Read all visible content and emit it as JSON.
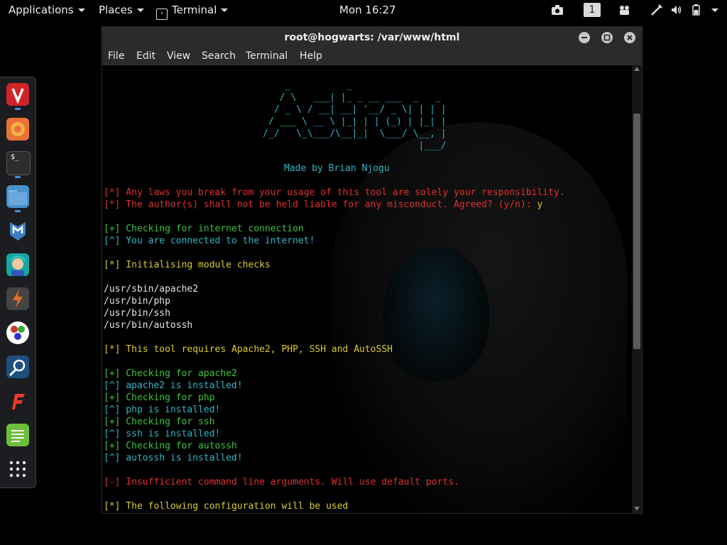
{
  "topbar": {
    "applications": "Applications",
    "places": "Places",
    "terminal": "Terminal",
    "clock": "Mon 16:27",
    "workspace": "1"
  },
  "window": {
    "title": "root@hogwarts: /var/www/html",
    "menu": [
      "File",
      "Edit",
      "View",
      "Search",
      "Terminal",
      "Help"
    ]
  },
  "dock": {
    "apps": [
      "vivaldi-icon",
      "firefox-icon",
      "terminal-icon",
      "files-icon",
      "metasploit-icon",
      "avatar-app-icon",
      "burpsuite-icon",
      "color-app-icon",
      "maltego-icon",
      "freeplane-icon",
      "notes-icon",
      "show-apps-icon"
    ]
  },
  "terminal": {
    "banner": [
      "        _          _",
      "       / \\   ___| |_ _ __ ___  _   _",
      "      / _ \\ / __| __| '__/ _ \\| | | |",
      "     / ___ \\ __ \\ |_| | | (_) | |_| |",
      "    /_/   \\_\\___/\\__|_|  \\___/ \\__, |",
      "                                |___/"
    ],
    "made_by": "Made by Brian Njogu",
    "lines": [
      {
        "text": "[*] Any laws you break from your usage of this tool are solely your responsibility.",
        "color": "red"
      },
      {
        "text": "[*] The author(s) shall not be held liable for any misconduct. Agreed? (y/n): ",
        "color": "red",
        "answer": "y"
      },
      {
        "text": "[+] Checking for internet connection",
        "color": "green"
      },
      {
        "text": "[^] You are connected to the internet!",
        "color": "cyan"
      },
      {
        "text": "[*] Initialising module checks",
        "color": "yellow"
      },
      {
        "text": "/usr/sbin/apache2",
        "color": "white"
      },
      {
        "text": "/usr/bin/php",
        "color": "white"
      },
      {
        "text": "/usr/bin/ssh",
        "color": "white"
      },
      {
        "text": "/usr/bin/autossh",
        "color": "white"
      },
      {
        "text": "[*] This tool requires Apache2, PHP, SSH and AutoSSH",
        "color": "yellow"
      },
      {
        "text": "[+] Checking for apache2",
        "color": "green"
      },
      {
        "text": "[^] apache2 is installed!",
        "color": "cyan"
      },
      {
        "text": "[+] Checking for php",
        "color": "green"
      },
      {
        "text": "[^] php is installed!",
        "color": "cyan"
      },
      {
        "text": "[+] Checking for ssh",
        "color": "green"
      },
      {
        "text": "[^] ssh is installed!",
        "color": "cyan"
      },
      {
        "text": "[+] Checking for autossh",
        "color": "green"
      },
      {
        "text": "[^] autossh is installed!",
        "color": "cyan"
      },
      {
        "text": "[-] Insufficient command line arguments. Will use default ports.",
        "color": "red"
      },
      {
        "text": "[*] The following configuration will be used",
        "color": "yellow"
      }
    ]
  }
}
